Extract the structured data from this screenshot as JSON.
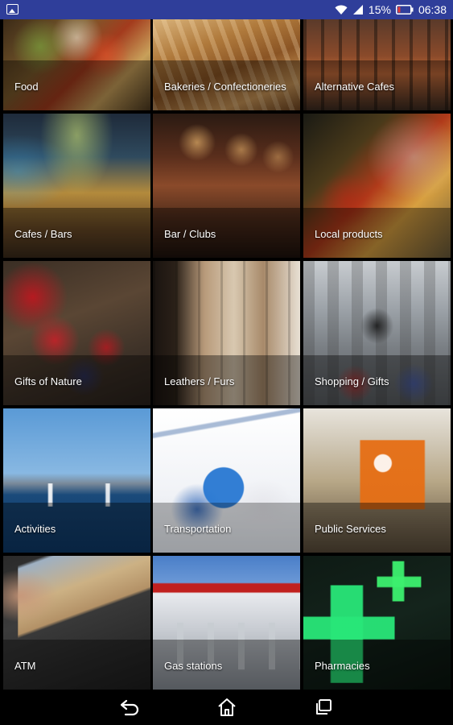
{
  "status_bar": {
    "battery_percent": "15%",
    "time": "06:38",
    "icons": [
      "image-notification-icon",
      "wifi-icon",
      "signal-icon",
      "battery-icon"
    ]
  },
  "categories": [
    {
      "label": "Food"
    },
    {
      "label": "Bakeries / Confectioneries"
    },
    {
      "label": "Alternative Cafes"
    },
    {
      "label": "Cafes / Bars"
    },
    {
      "label": "Bar / Clubs"
    },
    {
      "label": "Local products"
    },
    {
      "label": "Gifts of Nature"
    },
    {
      "label": "Leathers / Furs"
    },
    {
      "label": "Shopping / Gifts"
    },
    {
      "label": "Activities"
    },
    {
      "label": "Transportation"
    },
    {
      "label": "Public Services"
    },
    {
      "label": "ATM"
    },
    {
      "label": "Gas stations"
    },
    {
      "label": "Pharmacies"
    }
  ],
  "nav_bar": {
    "icons": [
      "back-icon",
      "home-icon",
      "recents-icon"
    ]
  }
}
